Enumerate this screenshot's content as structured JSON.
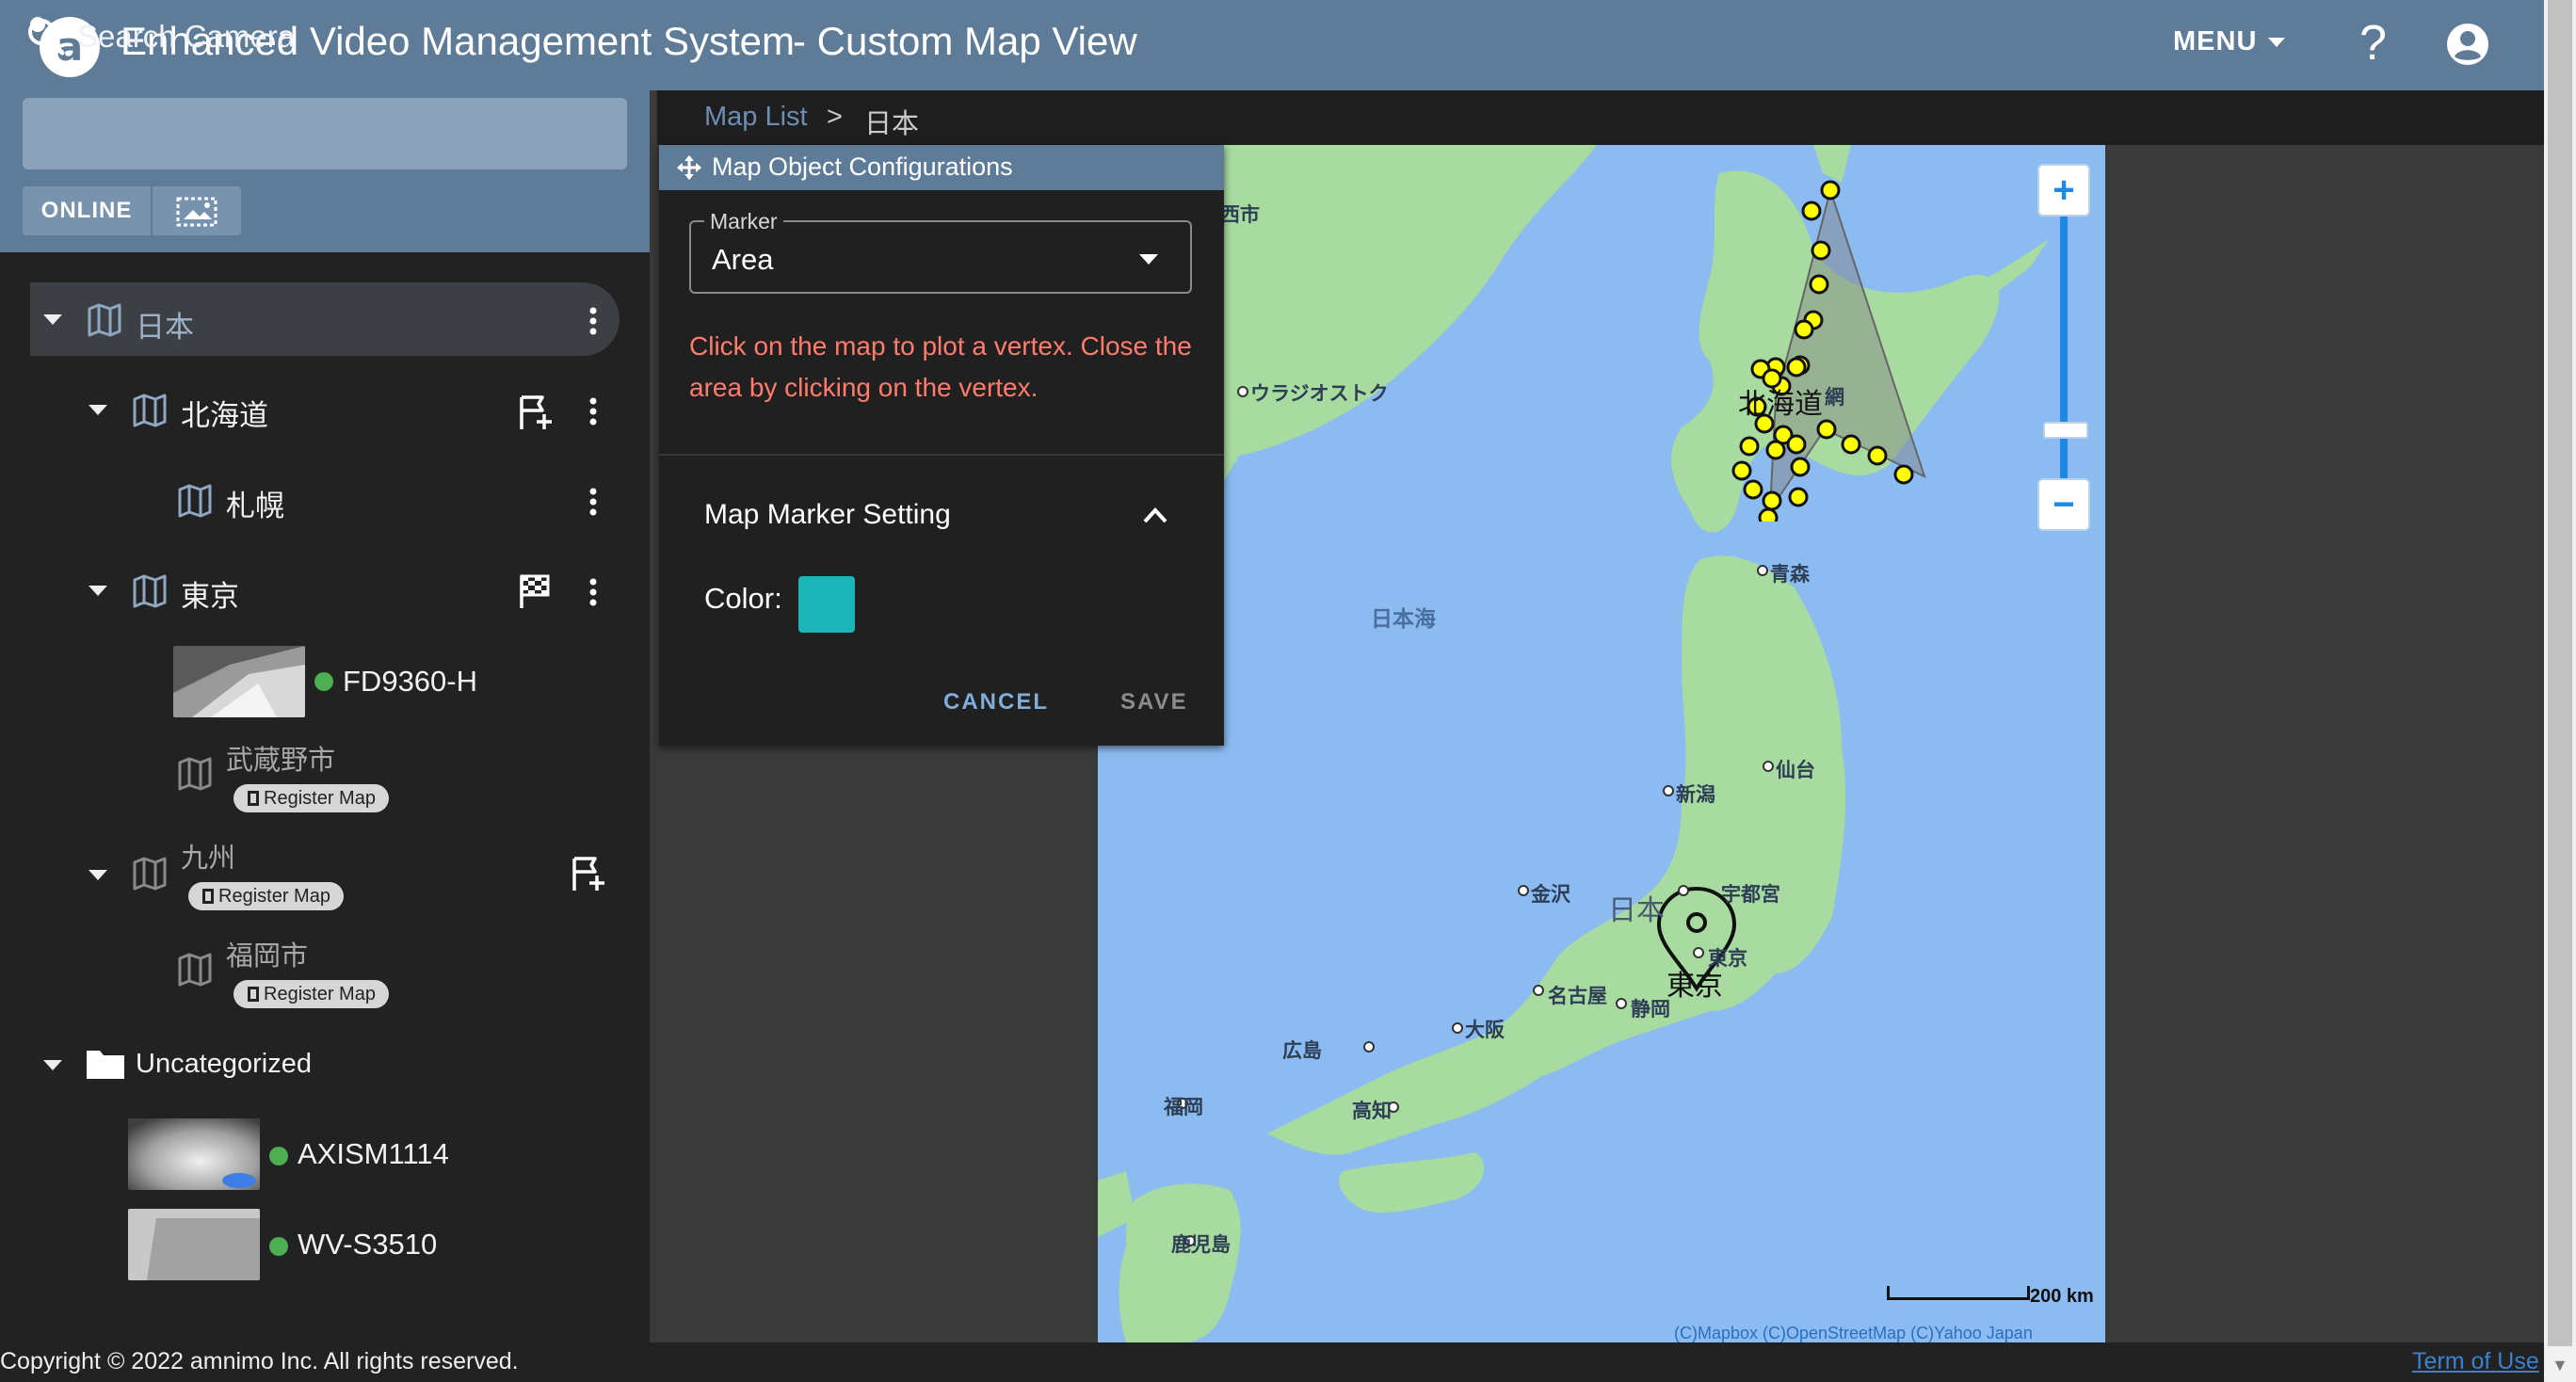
{
  "header": {
    "app_title": "Enhanced Video Management System",
    "view_title": "- Custom Map View",
    "menu_label": "MENU",
    "help_label": "?"
  },
  "sidebar": {
    "search_placeholder": "Search Camera",
    "filter_online": "ONLINE",
    "tree": {
      "root": "日本",
      "hokkaido": "北海道",
      "sapporo": "札幌",
      "tokyo": "東京",
      "camera_fd": "FD9360-H",
      "musashino": "武蔵野市",
      "kyushu": "九州",
      "fukuoka": "福岡市",
      "uncategorized": "Uncategorized",
      "camera_axis": "AXISM1114",
      "camera_wv": "WV-S3510",
      "register_map": "Register Map"
    }
  },
  "breadcrumb": {
    "link": "Map List",
    "separator": ">",
    "current": "日本"
  },
  "dialog": {
    "title": "Map Object Configurations",
    "marker_legend": "Marker",
    "marker_value": "Area",
    "hint": "Click on the map to plot a vertex. Close the area by clicking on the vertex.",
    "section_title": "Map Marker Setting",
    "color_label": "Color:",
    "color_value": "#1bb5b8",
    "cancel": "CANCEL",
    "save": "SAVE"
  },
  "map": {
    "labels": {
      "hokkaido": "北海道",
      "nihon": "日本",
      "tokyo_pin": "東京",
      "sea_of_japan": "日本海",
      "vladivostok": "ウラジオストク",
      "aomori": "青森",
      "sendai": "仙台",
      "niigata": "新潟",
      "kanazawa": "金沢",
      "utsunomiya": "宇都宮",
      "tokyo": "東京",
      "nagoya": "名古屋",
      "shizuoka": "静岡",
      "osaka": "大阪",
      "hiroshima": "広島",
      "kochi": "高知",
      "fukuoka": "福岡",
      "kagoshima": "鹿児島",
      "top_left_partial": "西市",
      "kushiro_partial": "網"
    },
    "scale": "200 km",
    "attribution": "(C)Mapbox  (C)OpenStreetMap  (C)Yahoo Japan",
    "area_vertex_color": "#ffff00",
    "land_color": "#a8dba0",
    "water_color": "#8bbbf0"
  },
  "footer": {
    "copyright": "Copyright © 2022 amnimo Inc. All rights reserved.",
    "terms": "Term of Use"
  }
}
